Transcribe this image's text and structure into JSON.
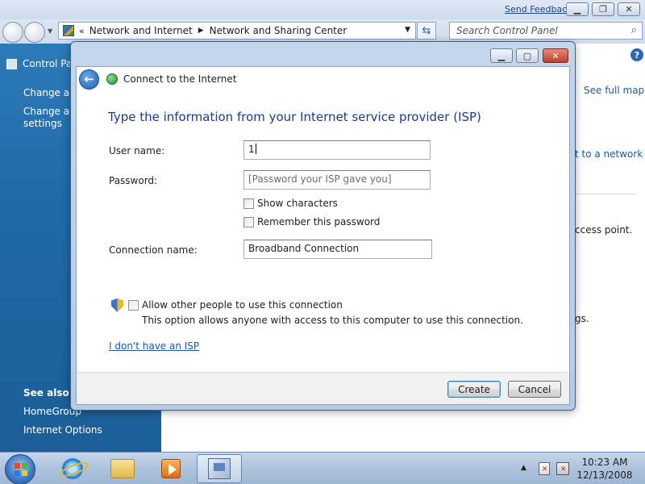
{
  "background_window": {
    "send_feedback": "Send Feedback",
    "address": {
      "chevron": "«",
      "crumbs": [
        "Network and Internet",
        "Network and Sharing Center"
      ]
    },
    "search_placeholder": "Search Control Panel",
    "sidebar": {
      "control_panel_label": "Control Pa",
      "links": [
        "Change ad",
        "Change ad",
        "settings"
      ],
      "see_also": "See also",
      "homegroup": "HomeGroup",
      "internet_options": "Internet Options"
    },
    "right_text": {
      "see_full_map": "See full map",
      "connect_network": "t to a network",
      "access_point": "ccess point.",
      "settings_fragment": "gs."
    }
  },
  "dialog": {
    "title": "Connect to the Internet",
    "heading": "Type the information from your Internet service provider (ISP)",
    "user_name": {
      "label": "User name:",
      "value": "1"
    },
    "password": {
      "label": "Password:",
      "placeholder": "[Password your ISP gave you]"
    },
    "show_characters": "Show characters",
    "remember_password": "Remember this password",
    "connection_name": {
      "label": "Connection name:",
      "value": "Broadband Connection"
    },
    "allow_others": "Allow other people to use this connection",
    "allow_desc": "This option allows anyone with access to this computer to use this connection.",
    "no_isp": "I don't have an ISP",
    "buttons": {
      "create": "Create",
      "cancel": "Cancel"
    }
  },
  "taskbar": {
    "clock_time": "10:23 AM",
    "clock_date": "12/13/2008"
  },
  "colors": {
    "sidebar_blue": "#1f6aa6",
    "heading_blue": "#1e3a8a",
    "link_blue": "#1c57a5"
  }
}
